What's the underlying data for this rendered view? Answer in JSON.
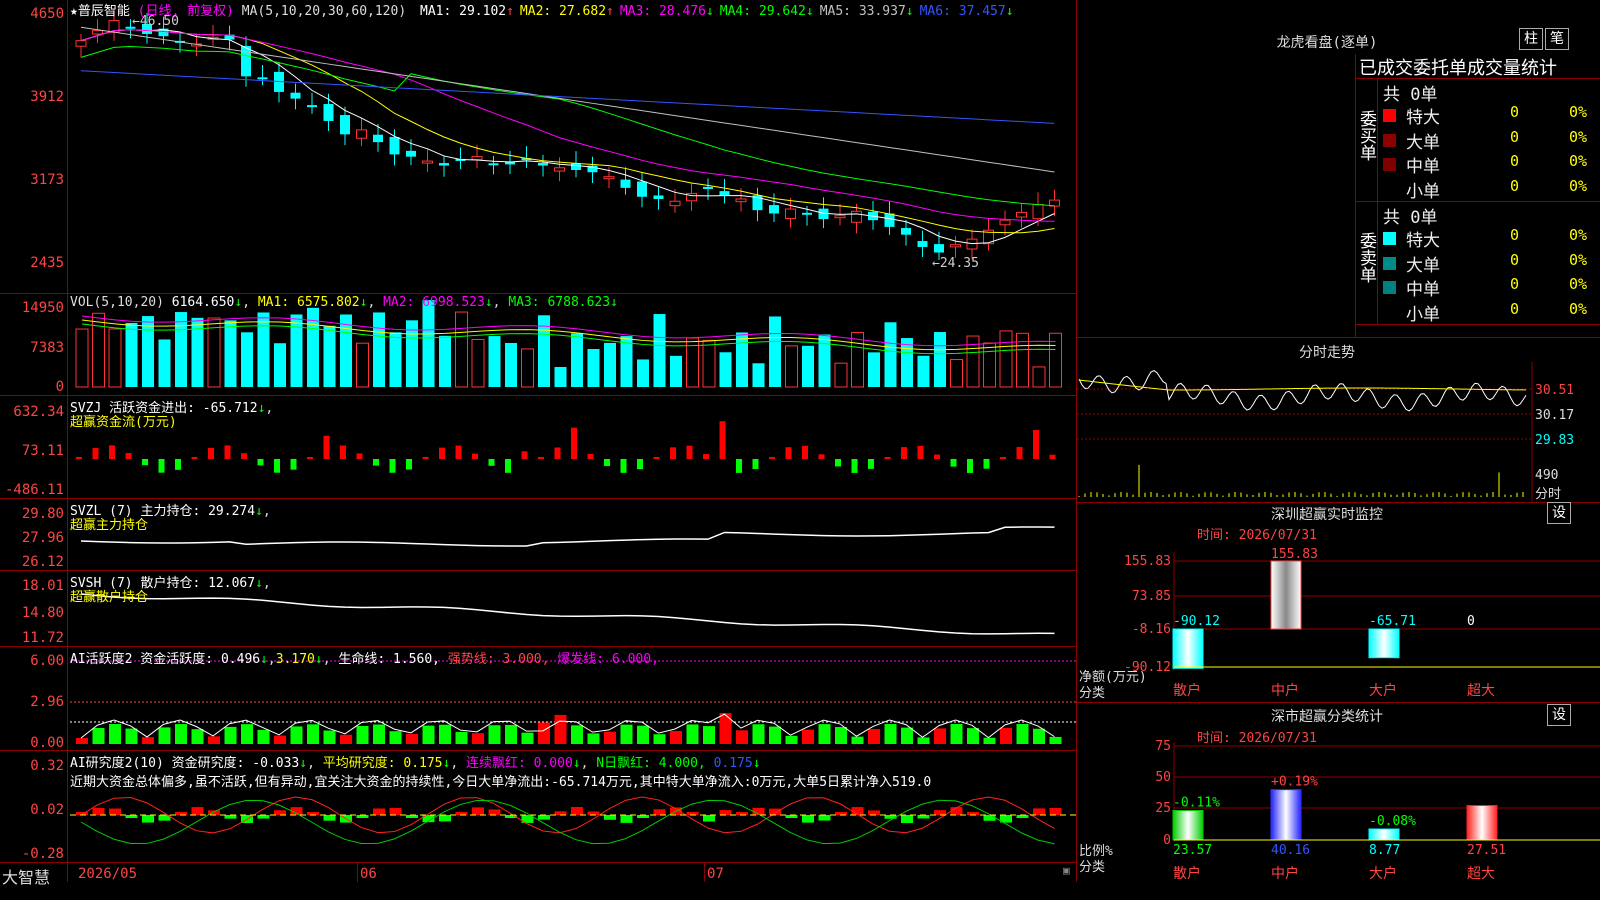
{
  "chart": {
    "name": "★普辰智能",
    "period": "(日线, 前复权)",
    "ma_label": "MA(5,10,20,30,60,120)",
    "ma": [
      {
        "label": "MA1: 29.102",
        "arrow": "↑",
        "color": "#ffffff"
      },
      {
        "label": "MA2: 27.682",
        "arrow": "↑",
        "color": "#ffff00"
      },
      {
        "label": "MA3: 28.476",
        "arrow": "↓",
        "color": "#ff00ff"
      },
      {
        "label": "MA4: 29.642",
        "arrow": "↓",
        "color": "#00ff00"
      },
      {
        "label": "MA5: 33.937",
        "arrow": "↓",
        "color": "#c0c0c0"
      },
      {
        "label": "MA6: 37.457",
        "arrow": "↓",
        "color": "#3355ff"
      }
    ],
    "price_axis": [
      "4650",
      "3912",
      "3173",
      "2435"
    ],
    "high_label": "←46.50",
    "low_label": "←24.35"
  },
  "vol": {
    "title": "VOL(5,10,20)",
    "value": "6164.650",
    "ma1": "MA1: 6575.802",
    "ma2": "MA2: 6998.523",
    "ma3": "MA3: 6788.623",
    "axis": [
      "14950",
      "7383",
      "0"
    ]
  },
  "svzj": {
    "title": "SVZJ  活跃资金进出: -65.712",
    "subtitle": "超赢资金流(万元)",
    "axis": [
      "632.34",
      "73.11",
      "-486.11"
    ]
  },
  "svzl": {
    "title": "SVZL (7) 主力持仓: 29.274",
    "subtitle": "超赢主力持仓",
    "axis": [
      "29.80",
      "27.96",
      "26.12"
    ]
  },
  "svsh": {
    "title": "SVSH (7) 散户持仓: 12.067",
    "subtitle": "超赢散户持仓",
    "axis": [
      "18.01",
      "14.80",
      "11.72"
    ]
  },
  "ai_active": {
    "title": "AI活跃度2 资金活跃度: 0.496",
    "v2": "3.170",
    "life": "生命线: 1.560,",
    "strong": "强势线: 3.000,",
    "burst": "爆发线: 6.000,",
    "axis": [
      "6.00",
      "2.96",
      "0.00"
    ]
  },
  "ai_research": {
    "title": "AI研究度2(10) 资金研究度: -0.033",
    "avg": "平均研究度: 0.175",
    "red": "连续飘红: 0.000",
    "nred": "N日飘红: 4.000,",
    "last": "0.175",
    "comment": "近期大资金总体偏多,虽不活跃,但有异动,宜关注大资金的持续性,今日大单净流出:-65.714万元,其中特大单净流入:0万元,大单5日累计净入519.0",
    "axis": [
      "0.32",
      "0.02",
      "-0.28"
    ]
  },
  "dates": {
    "brand": "大智慧",
    "d1": "2026/05",
    "d2": "06",
    "d3": "07"
  },
  "dragon": {
    "title": "龙虎看盘(逐单)",
    "btn1": "柱",
    "btn2": "笔",
    "subtitle": "已成交委托单成交量统计",
    "buy_label": "委买单",
    "sell_label": "委卖单",
    "buy_total": "共 0单",
    "sell_total": "共 0单",
    "buy": [
      {
        "name": "特大",
        "vol": "0",
        "pct": "0%",
        "color": "#ff0000"
      },
      {
        "name": "大单",
        "vol": "0",
        "pct": "0%",
        "color": "#8b0000"
      },
      {
        "name": "中单",
        "vol": "0",
        "pct": "0%",
        "color": "#800000"
      },
      {
        "name": "小单",
        "vol": "0",
        "pct": "0%",
        "color": ""
      }
    ],
    "sell": [
      {
        "name": "特大",
        "vol": "0",
        "pct": "0%",
        "color": "#00ffff"
      },
      {
        "name": "大单",
        "vol": "0",
        "pct": "0%",
        "color": "#008b8b"
      },
      {
        "name": "中单",
        "vol": "0",
        "pct": "0%",
        "color": "#008080"
      },
      {
        "name": "小单",
        "vol": "0",
        "pct": "0%",
        "color": ""
      }
    ]
  },
  "intraday": {
    "title": "分时走势",
    "p1": "30.51",
    "p2": "30.17",
    "p3": "29.83",
    "vol": "490",
    "unit": "分时"
  },
  "sz_monitor": {
    "title": "深圳超赢实时监控",
    "btn": "设",
    "time": "时间: 2026/07/31",
    "axis": [
      "155.83",
      "73.85",
      "-8.16",
      "-90.12"
    ],
    "ylabel1": "净额(万元)",
    "ylabel2": "分类",
    "cats": [
      "散户",
      "中户",
      "大户",
      "超大"
    ],
    "vals": [
      "-90.12",
      "155.83",
      "-65.71",
      "0"
    ]
  },
  "sz_stats": {
    "title": "深市超赢分类统计",
    "btn": "设",
    "time": "时间: 2026/07/31",
    "axis": [
      "75",
      "50",
      "25",
      "0"
    ],
    "ylabel1": "比例%",
    "ylabel2": "分类",
    "cats": [
      "散户",
      "中户",
      "大户",
      "超大"
    ],
    "vals": [
      "23.57",
      "40.16",
      "8.77",
      "27.51"
    ],
    "chg": [
      "-0.11%",
      "+0.19%",
      "-0.08%",
      ""
    ]
  }
}
